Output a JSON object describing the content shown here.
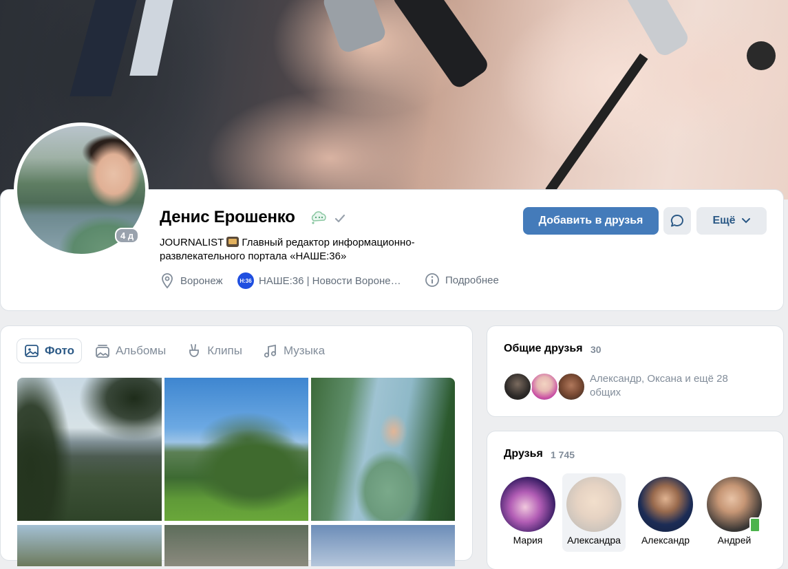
{
  "profile": {
    "name": "Денис Ерошенко",
    "last_seen": "4 д",
    "bio_prefix": "JOURNALIST",
    "bio_rest": "Главный редактор информационно-развлекательного портала «НАШЕ:36»",
    "city": "Воронеж",
    "work": "НАШЕ:36 | Новости Вороне…",
    "work_logo_text": "Н:36",
    "details": "Подробнее"
  },
  "actions": {
    "add_friend": "Добавить в друзья",
    "more": "Ещё"
  },
  "tabs": [
    {
      "label": "Фото",
      "icon": "photo-icon",
      "active": true
    },
    {
      "label": "Альбомы",
      "icon": "albums-icon",
      "active": false
    },
    {
      "label": "Клипы",
      "icon": "clips-icon",
      "active": false
    },
    {
      "label": "Музыка",
      "icon": "music-icon",
      "active": false
    }
  ],
  "common_friends": {
    "title": "Общие друзья",
    "count": "30",
    "text": "Александр, Оксана и ещё 28 общих"
  },
  "friends": {
    "title": "Друзья",
    "count": "1 745",
    "items": [
      {
        "name": "Мария"
      },
      {
        "name": "Александра"
      },
      {
        "name": "Александр"
      },
      {
        "name": "Андрей"
      }
    ]
  },
  "colors": {
    "accent": "#447bba",
    "link": "#2a5885",
    "muted": "#818c99",
    "page_bg": "#edeef0"
  }
}
